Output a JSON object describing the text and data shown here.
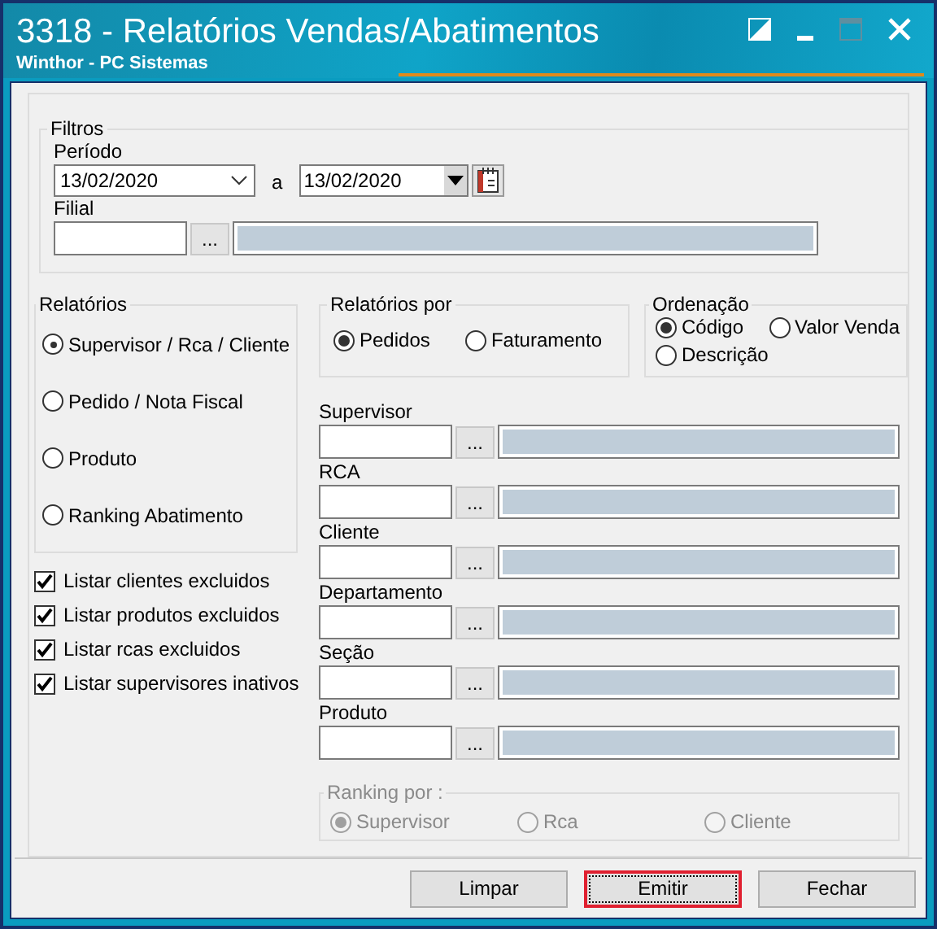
{
  "window": {
    "title": "3318 - Relatórios Vendas/Abatimentos",
    "subtitle": "Winthor - PC Sistemas"
  },
  "filtros": {
    "title": "Filtros",
    "periodo_label": "Período",
    "date_from": "13/02/2020",
    "separator": "a",
    "date_to": "13/02/2020",
    "filial_label": "Filial",
    "lookup_button": "..."
  },
  "relatorios": {
    "title": "Relatórios",
    "options": [
      {
        "label": "Supervisor / Rca / Cliente",
        "selected": true
      },
      {
        "label": "Pedido / Nota Fiscal",
        "selected": false
      },
      {
        "label": "Produto",
        "selected": false
      },
      {
        "label": "Ranking Abatimento",
        "selected": false
      }
    ]
  },
  "relatorios_por": {
    "title": "Relatórios por",
    "options": [
      {
        "label": "Pedidos",
        "selected": true
      },
      {
        "label": "Faturamento",
        "selected": false
      }
    ]
  },
  "ordenacao": {
    "title": "Ordenação",
    "options": [
      {
        "label": "Código",
        "selected": true
      },
      {
        "label": "Valor Venda",
        "selected": false
      },
      {
        "label": "Descrição",
        "selected": false
      }
    ]
  },
  "lookups": [
    {
      "label": "Supervisor",
      "button": "..."
    },
    {
      "label": "RCA",
      "button": "..."
    },
    {
      "label": "Cliente",
      "button": "..."
    },
    {
      "label": "Departamento",
      "button": "..."
    },
    {
      "label": "Seção",
      "button": "..."
    },
    {
      "label": "Produto",
      "button": "..."
    }
  ],
  "checkboxes": [
    {
      "label": "Listar clientes excluidos",
      "checked": true
    },
    {
      "label": "Listar produtos excluidos",
      "checked": true
    },
    {
      "label": "Listar rcas excluidos",
      "checked": true
    },
    {
      "label": "Listar supervisores inativos",
      "checked": true
    }
  ],
  "ranking_por": {
    "title": "Ranking por :",
    "disabled": true,
    "options": [
      {
        "label": "Supervisor",
        "selected": true
      },
      {
        "label": "Rca",
        "selected": false
      },
      {
        "label": "Cliente",
        "selected": false
      }
    ]
  },
  "buttons": [
    {
      "label": "Limpar",
      "focused": false
    },
    {
      "label": "Emitir",
      "focused": true
    },
    {
      "label": "Fechar",
      "focused": false
    }
  ]
}
